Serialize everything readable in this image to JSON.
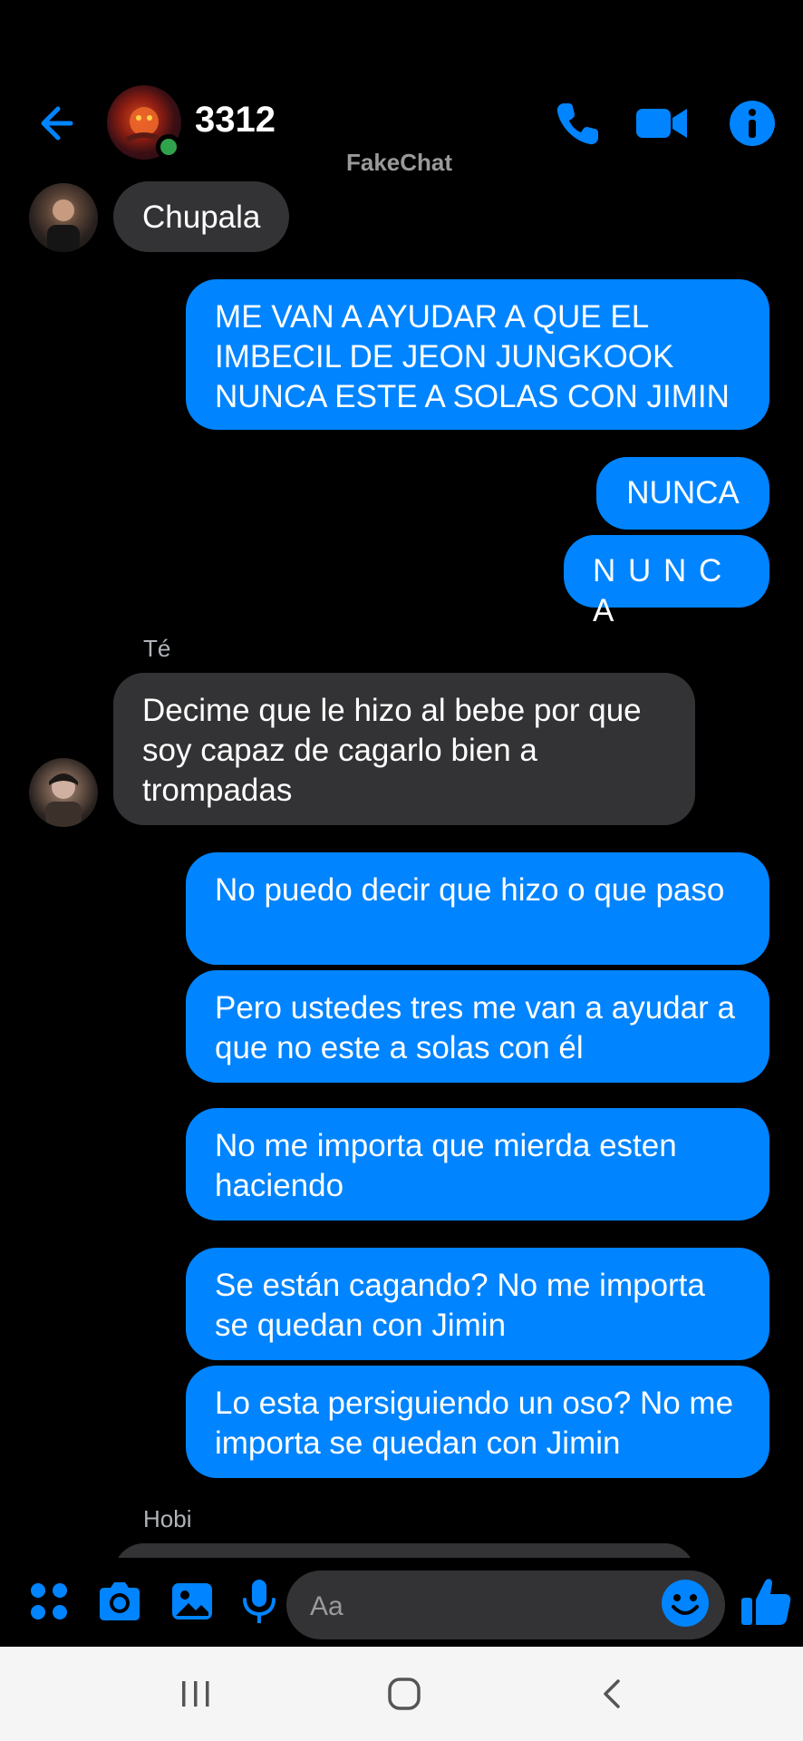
{
  "header": {
    "title": "3312",
    "watermark": "FakeChat",
    "icons": {
      "back": "back-arrow-icon",
      "call": "phone-icon",
      "video": "video-camera-icon",
      "info": "info-icon"
    },
    "accent_color": "#0084ff",
    "online_color": "#31a24c"
  },
  "messages": [
    {
      "side": "incoming",
      "text": "Chupala"
    },
    {
      "side": "outgoing",
      "text": "ME VAN A AYUDAR A QUE EL IMBECIL DE JEON JUNGKOOK NUNCA ESTE A SOLAS CON JIMIN"
    },
    {
      "side": "outgoing",
      "text": "NUNCA"
    },
    {
      "side": "outgoing",
      "text": "N U N C A"
    },
    {
      "side": "incoming",
      "sender": "Té",
      "text": "Decime que le hizo al bebe por que soy capaz de cagarlo bien a trompadas"
    },
    {
      "side": "outgoing",
      "text": "No puedo decir que hizo o que paso"
    },
    {
      "side": "outgoing",
      "text": "Pero ustedes tres me van a ayudar a que no este a solas con él"
    },
    {
      "side": "outgoing",
      "text": "No me importa que mierda esten haciendo"
    },
    {
      "side": "outgoing",
      "text": "Se están cagando? No me importa se quedan con Jimin"
    },
    {
      "side": "outgoing",
      "text": "Lo esta persiguiendo un oso? No me importa se quedan con Jimin"
    },
    {
      "side": "incoming",
      "sender": "Hobi",
      "text": ""
    }
  ],
  "composer": {
    "placeholder": "Aa",
    "icons": [
      "apps-grid-icon",
      "camera-icon",
      "gallery-icon",
      "microphone-icon",
      "emoji-icon",
      "thumbs-up-icon"
    ]
  },
  "system_nav": {
    "icons": [
      "recents-icon",
      "home-icon",
      "back-icon"
    ]
  }
}
